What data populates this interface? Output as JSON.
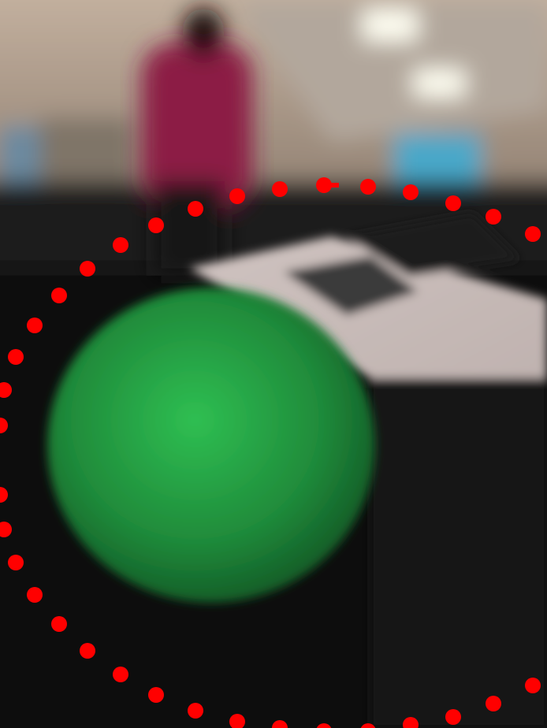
{
  "scene": {
    "kind": "blurred-photo-with-dot-overlay",
    "subject": "green-ball",
    "overlay_color": "#ff0000",
    "ball_color": "#1f8a3a"
  }
}
